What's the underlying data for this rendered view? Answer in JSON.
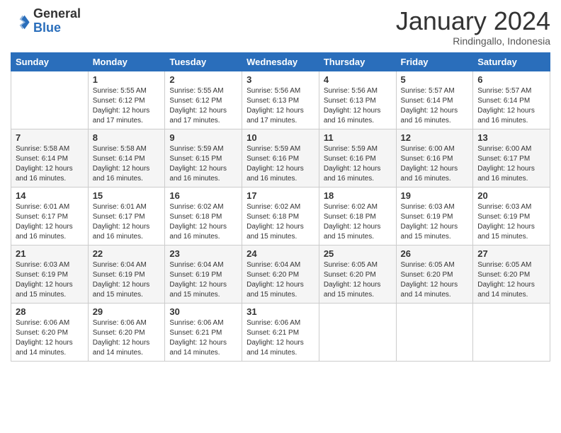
{
  "header": {
    "logo_general": "General",
    "logo_blue": "Blue",
    "month": "January 2024",
    "location": "Rindingallo, Indonesia"
  },
  "weekdays": [
    "Sunday",
    "Monday",
    "Tuesday",
    "Wednesday",
    "Thursday",
    "Friday",
    "Saturday"
  ],
  "rows": [
    [
      {
        "day": "",
        "sunrise": "",
        "sunset": "",
        "daylight": ""
      },
      {
        "day": "1",
        "sunrise": "Sunrise: 5:55 AM",
        "sunset": "Sunset: 6:12 PM",
        "daylight": "Daylight: 12 hours and 17 minutes."
      },
      {
        "day": "2",
        "sunrise": "Sunrise: 5:55 AM",
        "sunset": "Sunset: 6:12 PM",
        "daylight": "Daylight: 12 hours and 17 minutes."
      },
      {
        "day": "3",
        "sunrise": "Sunrise: 5:56 AM",
        "sunset": "Sunset: 6:13 PM",
        "daylight": "Daylight: 12 hours and 17 minutes."
      },
      {
        "day": "4",
        "sunrise": "Sunrise: 5:56 AM",
        "sunset": "Sunset: 6:13 PM",
        "daylight": "Daylight: 12 hours and 16 minutes."
      },
      {
        "day": "5",
        "sunrise": "Sunrise: 5:57 AM",
        "sunset": "Sunset: 6:14 PM",
        "daylight": "Daylight: 12 hours and 16 minutes."
      },
      {
        "day": "6",
        "sunrise": "Sunrise: 5:57 AM",
        "sunset": "Sunset: 6:14 PM",
        "daylight": "Daylight: 12 hours and 16 minutes."
      }
    ],
    [
      {
        "day": "7",
        "sunrise": "",
        "sunset": "",
        "daylight": ""
      },
      {
        "day": "8",
        "sunrise": "Sunrise: 5:58 AM",
        "sunset": "Sunset: 6:14 PM",
        "daylight": "Daylight: 12 hours and 16 minutes."
      },
      {
        "day": "9",
        "sunrise": "Sunrise: 5:59 AM",
        "sunset": "Sunset: 6:15 PM",
        "daylight": "Daylight: 12 hours and 16 minutes."
      },
      {
        "day": "10",
        "sunrise": "Sunrise: 5:59 AM",
        "sunset": "Sunset: 6:16 PM",
        "daylight": "Daylight: 12 hours and 16 minutes."
      },
      {
        "day": "11",
        "sunrise": "Sunrise: 5:59 AM",
        "sunset": "Sunset: 6:16 PM",
        "daylight": "Daylight: 12 hours and 16 minutes."
      },
      {
        "day": "12",
        "sunrise": "Sunrise: 6:00 AM",
        "sunset": "Sunset: 6:16 PM",
        "daylight": "Daylight: 12 hours and 16 minutes."
      },
      {
        "day": "13",
        "sunrise": "Sunrise: 6:00 AM",
        "sunset": "Sunset: 6:17 PM",
        "daylight": "Daylight: 12 hours and 16 minutes."
      }
    ],
    [
      {
        "day": "14",
        "sunrise": "",
        "sunset": "",
        "daylight": ""
      },
      {
        "day": "15",
        "sunrise": "Sunrise: 6:01 AM",
        "sunset": "Sunset: 6:17 PM",
        "daylight": "Daylight: 12 hours and 16 minutes."
      },
      {
        "day": "16",
        "sunrise": "Sunrise: 6:02 AM",
        "sunset": "Sunset: 6:18 PM",
        "daylight": "Daylight: 12 hours and 16 minutes."
      },
      {
        "day": "17",
        "sunrise": "Sunrise: 6:02 AM",
        "sunset": "Sunset: 6:18 PM",
        "daylight": "Daylight: 12 hours and 15 minutes."
      },
      {
        "day": "18",
        "sunrise": "Sunrise: 6:02 AM",
        "sunset": "Sunset: 6:18 PM",
        "daylight": "Daylight: 12 hours and 15 minutes."
      },
      {
        "day": "19",
        "sunrise": "Sunrise: 6:03 AM",
        "sunset": "Sunset: 6:19 PM",
        "daylight": "Daylight: 12 hours and 15 minutes."
      },
      {
        "day": "20",
        "sunrise": "Sunrise: 6:03 AM",
        "sunset": "Sunset: 6:19 PM",
        "daylight": "Daylight: 12 hours and 15 minutes."
      }
    ],
    [
      {
        "day": "21",
        "sunrise": "",
        "sunset": "",
        "daylight": ""
      },
      {
        "day": "22",
        "sunrise": "Sunrise: 6:04 AM",
        "sunset": "Sunset: 6:19 PM",
        "daylight": "Daylight: 12 hours and 15 minutes."
      },
      {
        "day": "23",
        "sunrise": "Sunrise: 6:04 AM",
        "sunset": "Sunset: 6:19 PM",
        "daylight": "Daylight: 12 hours and 15 minutes."
      },
      {
        "day": "24",
        "sunrise": "Sunrise: 6:04 AM",
        "sunset": "Sunset: 6:20 PM",
        "daylight": "Daylight: 12 hours and 15 minutes."
      },
      {
        "day": "25",
        "sunrise": "Sunrise: 6:05 AM",
        "sunset": "Sunset: 6:20 PM",
        "daylight": "Daylight: 12 hours and 15 minutes."
      },
      {
        "day": "26",
        "sunrise": "Sunrise: 6:05 AM",
        "sunset": "Sunset: 6:20 PM",
        "daylight": "Daylight: 12 hours and 14 minutes."
      },
      {
        "day": "27",
        "sunrise": "Sunrise: 6:05 AM",
        "sunset": "Sunset: 6:20 PM",
        "daylight": "Daylight: 12 hours and 14 minutes."
      }
    ],
    [
      {
        "day": "28",
        "sunrise": "Sunrise: 6:06 AM",
        "sunset": "Sunset: 6:20 PM",
        "daylight": "Daylight: 12 hours and 14 minutes."
      },
      {
        "day": "29",
        "sunrise": "Sunrise: 6:06 AM",
        "sunset": "Sunset: 6:20 PM",
        "daylight": "Daylight: 12 hours and 14 minutes."
      },
      {
        "day": "30",
        "sunrise": "Sunrise: 6:06 AM",
        "sunset": "Sunset: 6:21 PM",
        "daylight": "Daylight: 12 hours and 14 minutes."
      },
      {
        "day": "31",
        "sunrise": "Sunrise: 6:06 AM",
        "sunset": "Sunset: 6:21 PM",
        "daylight": "Daylight: 12 hours and 14 minutes."
      },
      {
        "day": "",
        "sunrise": "",
        "sunset": "",
        "daylight": ""
      },
      {
        "day": "",
        "sunrise": "",
        "sunset": "",
        "daylight": ""
      },
      {
        "day": "",
        "sunrise": "",
        "sunset": "",
        "daylight": ""
      }
    ]
  ],
  "row7_sun": {
    "sunrise": "Sunrise: 5:58 AM",
    "sunset": "Sunset: 6:14 PM",
    "daylight": "Daylight: 12 hours and 16 minutes."
  },
  "row14_sun": {
    "sunrise": "Sunrise: 6:01 AM",
    "sunset": "Sunset: 6:17 PM",
    "daylight": "Daylight: 12 hours and 16 minutes."
  },
  "row21_sun": {
    "sunrise": "Sunrise: 6:03 AM",
    "sunset": "Sunset: 6:19 PM",
    "daylight": "Daylight: 12 hours and 15 minutes."
  }
}
